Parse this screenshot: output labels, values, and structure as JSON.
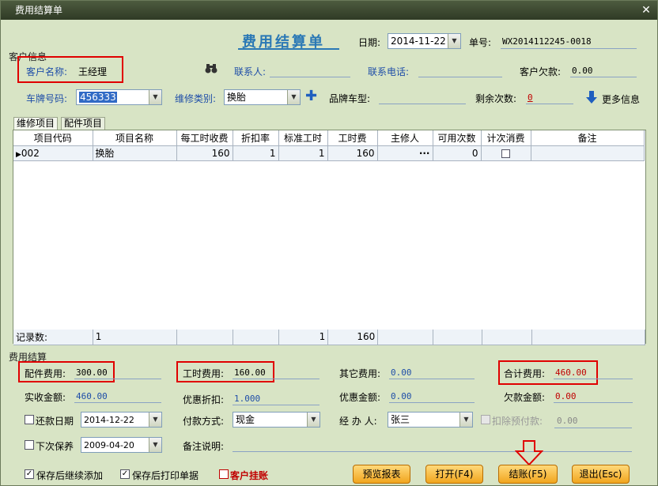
{
  "window": {
    "title": "费用结算单",
    "close_glyph": "✕"
  },
  "header": {
    "page_title": "费用结算单",
    "date_label": "日期:",
    "date_value": "2014-11-22",
    "order_no_label": "单号:",
    "order_no_value": "WX2014112245-0018"
  },
  "customer": {
    "section_label": "客户信息",
    "name_label": "客户名称:",
    "name_value": "王经理",
    "contact_label": "联系人:",
    "phone_label": "联系电话:",
    "debt_label": "客户欠款:",
    "debt_value": "0.00",
    "plate_label": "车牌号码:",
    "plate_value": "456333",
    "repair_type_label": "维修类别:",
    "repair_type_value": "换胎",
    "brand_label": "品牌车型:",
    "remaining_label": "剩余次数:",
    "remaining_value": "0",
    "more_info_label": "更多信息"
  },
  "tabs": [
    {
      "label": "维修项目"
    },
    {
      "label": "配件项目"
    }
  ],
  "grid": {
    "columns": [
      "项目代码",
      "项目名称",
      "每工时收费",
      "折扣率",
      "标准工时",
      "工时费",
      "主修人",
      "可用次数",
      "计次消费",
      "备注"
    ],
    "rows": [
      {
        "code": "002",
        "name": "换胎",
        "rate": "160",
        "discount": "1",
        "std_hours": "1",
        "fee": "160",
        "worker": "",
        "worker_btn": "···",
        "uses": "0"
      }
    ],
    "footer": {
      "label": "记录数:",
      "count": "1",
      "std_hours": "1",
      "fee": "160"
    }
  },
  "settlement": {
    "section_label": "费用结算",
    "parts_fee_label": "配件费用:",
    "parts_fee_value": "300.00",
    "labor_fee_label": "工时费用:",
    "labor_fee_value": "160.00",
    "other_fee_label": "其它费用:",
    "other_fee_value": "0.00",
    "total_label": "合计费用:",
    "total_value": "460.00",
    "received_label": "实收金额:",
    "received_value": "460.00",
    "discount_label": "优惠折扣:",
    "discount_value": "1.000",
    "discount_amount_label": "优惠金额:",
    "discount_amount_value": "0.00",
    "owed_label": "欠款金额:",
    "owed_value": "0.00",
    "repay_date_label": "还款日期",
    "repay_date_value": "2014-12-22",
    "payment_label": "付款方式:",
    "payment_value": "现金",
    "handler_label": "经 办 人:",
    "handler_value": "张三",
    "deduct_prepay_label": "扣除预付款:",
    "deduct_prepay_value": "0.00",
    "next_service_label": "下次保养",
    "next_service_value": "2009-04-20",
    "remark_label": "备注说明:"
  },
  "footer": {
    "continue_add_label": "保存后继续添加",
    "print_after_save_label": "保存后打印单据",
    "customer_hang_label": "客户挂账",
    "preview_btn": "预览报表",
    "open_btn": "打开(F4)",
    "checkout_btn": "结账(F5)",
    "exit_btn": "退出(Esc)"
  },
  "colors": {
    "accent_blue": "#1f4ea8",
    "highlight_red": "#e00000",
    "button_orange": "#f1a51e",
    "background": "#d8e4c5"
  }
}
